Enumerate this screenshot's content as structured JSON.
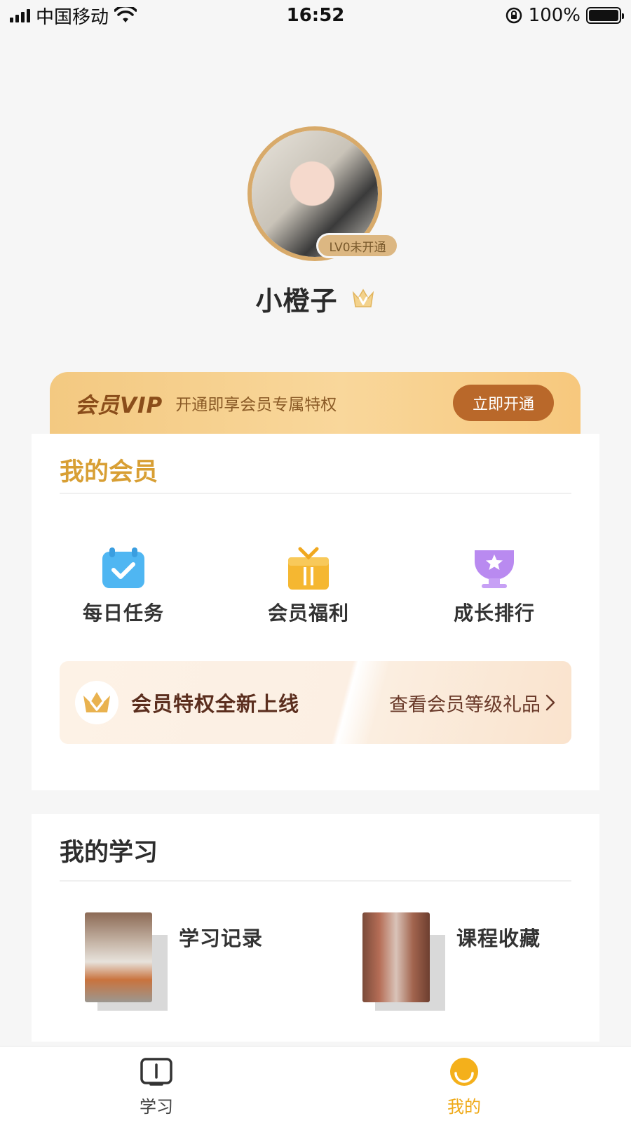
{
  "status_bar": {
    "carrier": "中国移动",
    "time": "16:52",
    "battery": "100%",
    "battery_level": 1.0
  },
  "profile": {
    "level_badge": "LV0未开通",
    "username": "小橙子"
  },
  "vip_banner": {
    "title": "会员VIP",
    "description": "开通即享会员专属特权",
    "button_label": "立即开通"
  },
  "membership": {
    "title": "我的会员",
    "features": [
      {
        "label": "每日任务",
        "icon": "calendar-check-icon",
        "color": "#4fb6f2"
      },
      {
        "label": "会员福利",
        "icon": "gift-icon",
        "color": "#f5b731"
      },
      {
        "label": "成长排行",
        "icon": "trophy-icon",
        "color": "#b98af0"
      }
    ],
    "privilege": {
      "title": "会员特权全新上线",
      "link": "查看会员等级礼品"
    }
  },
  "learning": {
    "title": "我的学习",
    "items": [
      {
        "label": "学习记录"
      },
      {
        "label": "课程收藏"
      }
    ]
  },
  "tab_bar": {
    "tabs": [
      {
        "label": "学习",
        "icon": "book-icon",
        "active": false
      },
      {
        "label": "我的",
        "icon": "smile-icon",
        "active": true
      }
    ],
    "active_color": "#efaa19"
  }
}
